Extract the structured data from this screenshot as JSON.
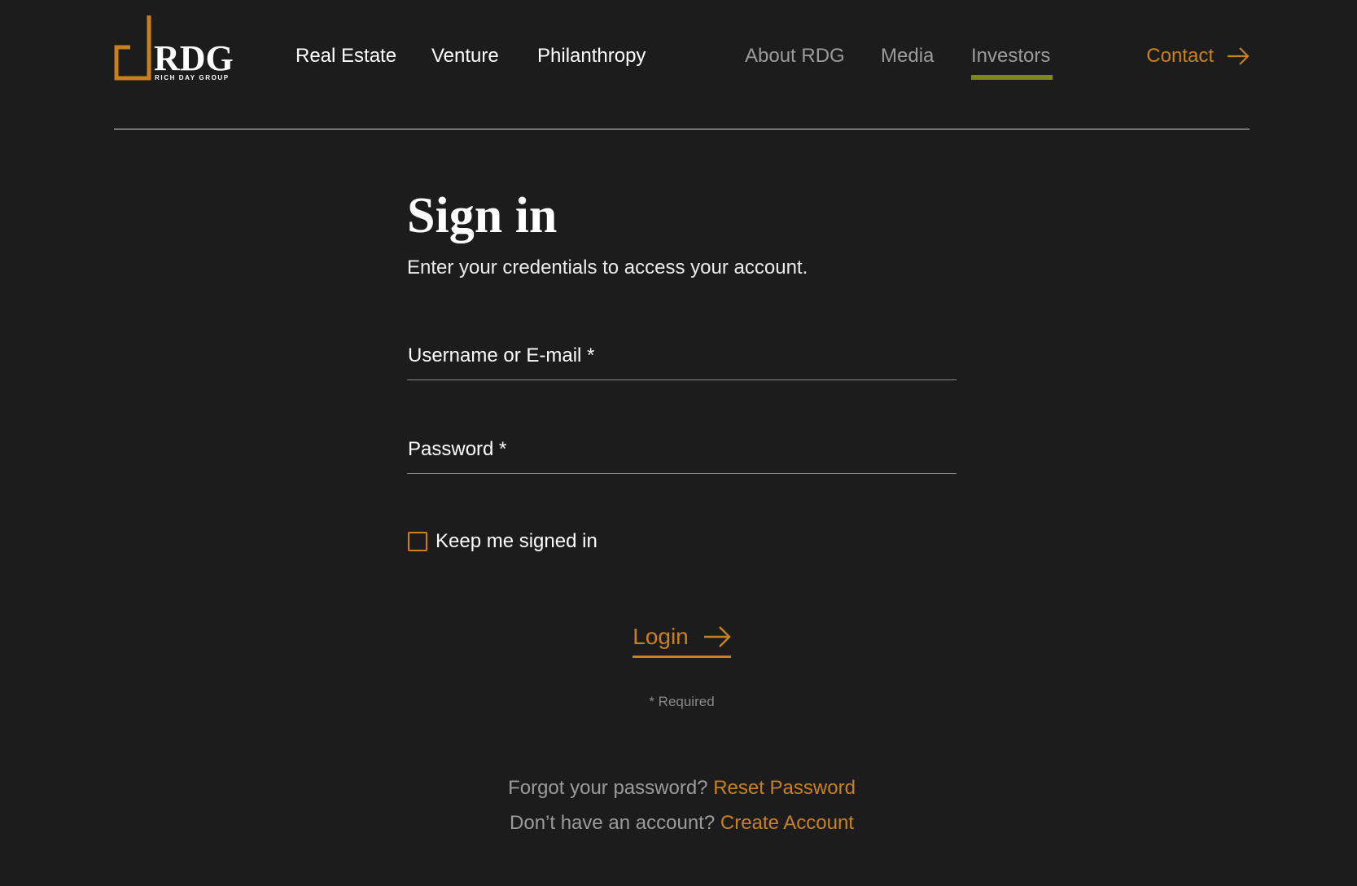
{
  "brand": {
    "logo_text": "RDG",
    "logo_subtitle": "RICH DAY GROUP"
  },
  "nav": {
    "primary": [
      "Real Estate",
      "Venture",
      "Philanthropy"
    ],
    "secondary": [
      "About RDG",
      "Media",
      "Investors"
    ],
    "active": "Investors",
    "contact_label": "Contact"
  },
  "signin": {
    "title": "Sign in",
    "subtitle": "Enter your credentials to access your account.",
    "username_label": "Username or E-mail *",
    "password_label": "Password *",
    "keep_signed_in_label": "Keep me signed in",
    "keep_signed_in_checked": false,
    "login_label": "Login",
    "required_note": "* Required"
  },
  "help": {
    "forgot_prompt": "Forgot your password?",
    "reset_link": "Reset Password",
    "no_account_prompt": "Don’t have an account?",
    "create_link": "Create Account"
  },
  "colors": {
    "background": "#1c1c1c",
    "accent": "#c8811c",
    "active_underline": "#7c8a12",
    "muted_text": "#9b9b9b"
  },
  "icons": {
    "contact_arrow": "arrow-right-icon",
    "login_arrow": "arrow-right-icon"
  }
}
